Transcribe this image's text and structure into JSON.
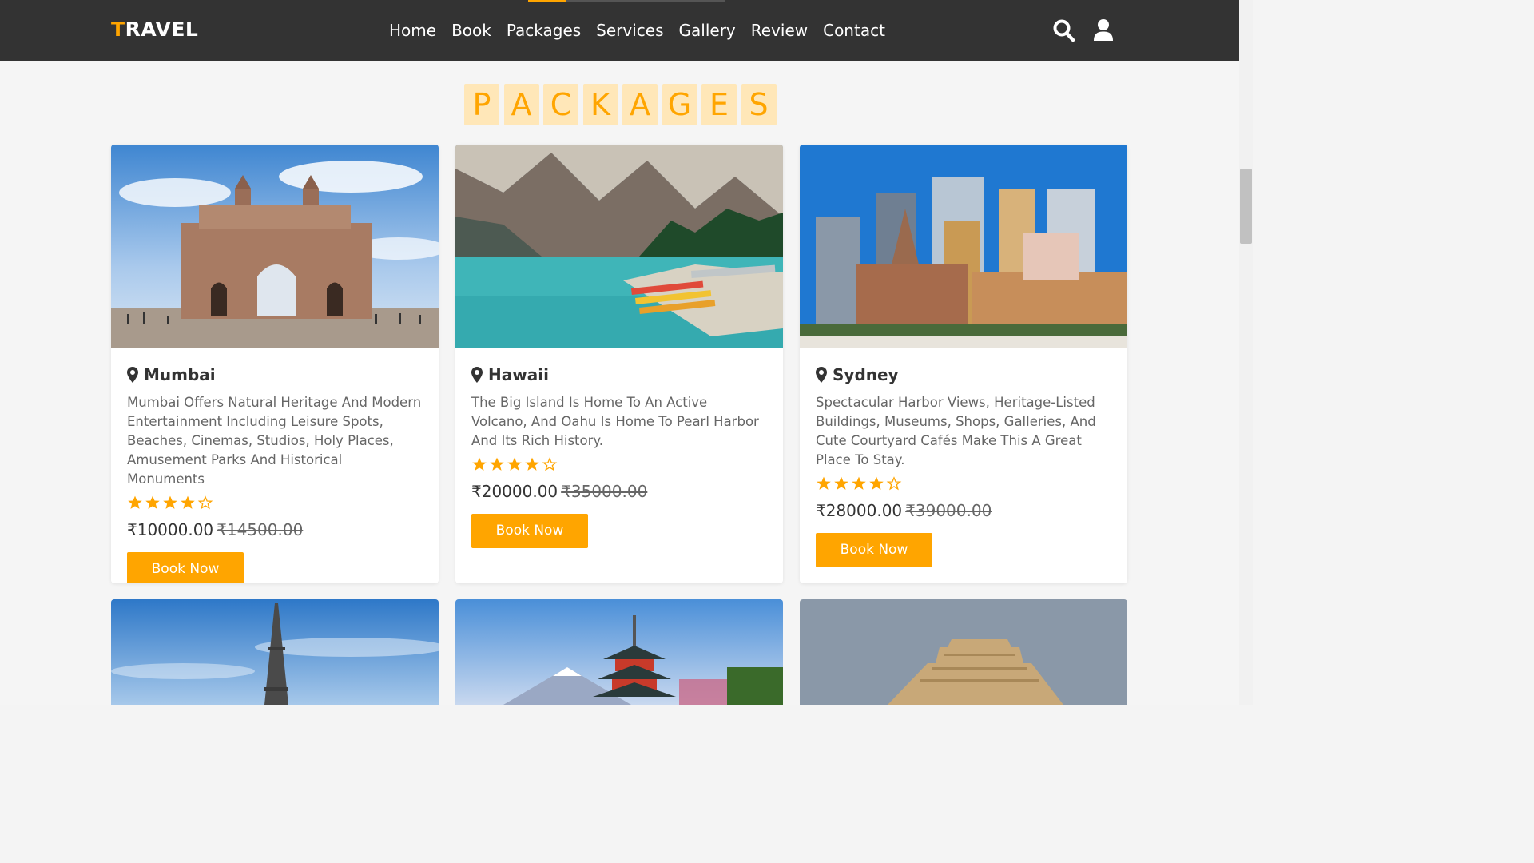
{
  "brand": {
    "first_letter": "T",
    "rest": "RAVEL"
  },
  "nav": [
    "Home",
    "Book",
    "Packages",
    "Services",
    "Gallery",
    "Review",
    "Contact"
  ],
  "section_title": [
    "P",
    "A",
    "C",
    "K",
    "A",
    "G",
    "E",
    "S"
  ],
  "packages": [
    {
      "name": "Mumbai",
      "desc": "Mumbai Offers Natural Heritage And Modern Entertainment Including Leisure Spots, Beaches, Cinemas, Studios, Holy Places, Amusement Parks And Historical Monuments",
      "rating": 4,
      "price": "₹10000.00",
      "old_price": "₹14500.00",
      "button": "Book Now"
    },
    {
      "name": "Hawaii",
      "desc": "The Big Island Is Home To An Active Volcano, And Oahu Is Home To Pearl Harbor And Its Rich History.",
      "rating": 4,
      "price": "₹20000.00",
      "old_price": "₹35000.00",
      "button": "Book Now"
    },
    {
      "name": "Sydney",
      "desc": "Spectacular Harbor Views, Heritage-Listed Buildings, Museums, Shops, Galleries, And Cute Courtyard Cafés Make This A Great Place To Stay.",
      "rating": 4,
      "price": "₹28000.00",
      "old_price": "₹39000.00",
      "button": "Book Now"
    }
  ],
  "colors": {
    "accent": "#ffa500",
    "header_bg": "#333333",
    "title_bg": "#ffe7b8"
  },
  "icons": {
    "search": "search-icon",
    "user": "user-icon",
    "pin": "map-pin-icon",
    "star_full": "star-icon",
    "star_empty": "star-outline-icon"
  }
}
